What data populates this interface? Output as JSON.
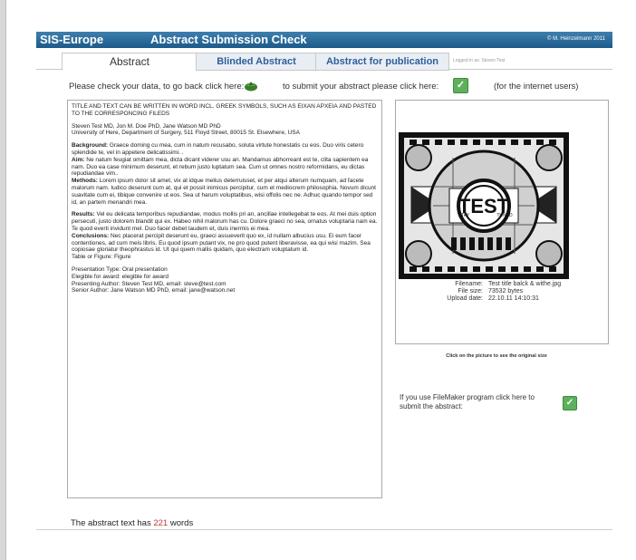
{
  "header": {
    "app_name": "SIS-Europe",
    "title": "Abstract Submission Check",
    "copyright": "© M. Heinzelmann 2011"
  },
  "tabs": [
    {
      "label": "Abstract",
      "active": true
    },
    {
      "label": "Blinded Abstract",
      "active": false
    },
    {
      "label": "Abstract for publication",
      "active": false
    }
  ],
  "logged_in": "Logged in as: Steven Test",
  "check_line": {
    "back_text": "Please check your data, to go back click here:",
    "submit_text": "to submit your abstract please click here:",
    "internet_users": "(for the internet users)"
  },
  "abstract": {
    "title": "TITLE AND TEXT CAN BE WRITTEN IN WORD INCL. GREEK SYMBOLS, SUCH AS ΕΙΧΑΝ ΑΡΧΕΙΑ AND PASTED TO THE CORRESPONCING FILEDS",
    "authors": "Steven Test MD, Jon M. Doe PhD, Jane Watson MD PhD",
    "affiliation": "University of Here, Department of Surgery, 511 Floyd Street, 80015 St. Elsewhere, USA",
    "background_label": "Background:",
    "background": " Graece doming cu mea, cum in natum recusabo, soluta virtute honestatis cu eos. Duo viris cetero splendide te, vel in appetere delicatissimi. .",
    "aim_label": "Aim:",
    "aim": " Ne natum feugiat omittam mea, dicta dicant viderer usu an. Mandamus abhorreant est te, clita sapientem ea nam. Duo ea case minimum deserunt, et rebum justo luptatum sea. Cum ut omnes nostro reformidans, eu dictas repudiandae vim..",
    "methods_label": "Methods:",
    "methods": " Lorem ipsum dolor sit amet, vix at idque melius deterruisset, et per atqui alterum numquam, ad facete malorum nam. Iudico deserunt cum at, qui et possit inimicus percipitur, cum et mediocrem philosophia. Novum dicunt suavitate cum ei, tibique convenire ut eos. Sea ut harum voluptatibus, wisi offolis nec ne. Adhuc quando tempor sed id, an partem menandri mea.",
    "results_label": "Results:",
    "results": " Vel eu delicata temporibus repudiandae, modus mollis pri an, ancillae intellegebat te eos. At mei duis option persecuti, justo dolorem blandit qui ex. Habeo nihil malorum has cu. Dolore graeci no sea, ornatus voluptaria nam ea. Te quod everti invidunt mel. Duo facer debet laudem et, duis inermis ei mea.",
    "conclusions_label": "Conclusions:",
    "conclusions": " Nec placerat percipit deserunt eu, graeci assueverit quo ex, id nullam albucius usu. Ei eum facer contentiones, ad cum meis libris. Eu quod ipsum putant vix, ne pro quod putent liberavisse, ea qui wisi mazim. Sea copiosae gloriatur theophrastus id. Ut qui quem mallis quidam, quo electram voluptatum id.",
    "table_figure": "Table or Figure: Figure",
    "presentation_type": "Presentation Type: Oral presentation",
    "elegible": "Elegible for award: elegible for award",
    "presenting_author": "Presenting Author: Steven Test MD, email: steve@test.com",
    "senior_author": "Senior Author: Jane Watson MD PhD, email: jane@watson.net"
  },
  "image": {
    "test_word": "TEST",
    "stay": "STAY",
    "tuned": "TUNED",
    "filename_label": "Filename:",
    "filename": "Test title balck & withe.jpg",
    "filesize_label": "File size:",
    "filesize": "73532 bytes",
    "upload_label": "Upload date:",
    "upload_date": "22.10.11 14:10:31",
    "click_hint": "Click on the picture to see the original size"
  },
  "filemaker": {
    "text": "If you use FileMaker program click here to submit the abstract:"
  },
  "wordcount": {
    "prefix": "The abstract text has",
    "count": "221",
    "suffix": "words"
  },
  "colors": {
    "header": "#2a6796",
    "tab_text": "#2f5f9a",
    "check_green": "#5eb15c",
    "count_red": "#c0392b"
  },
  "icons": {
    "back": "leaf-back-icon",
    "submit": "checkmark-icon",
    "filemaker": "checkmark-icon"
  }
}
